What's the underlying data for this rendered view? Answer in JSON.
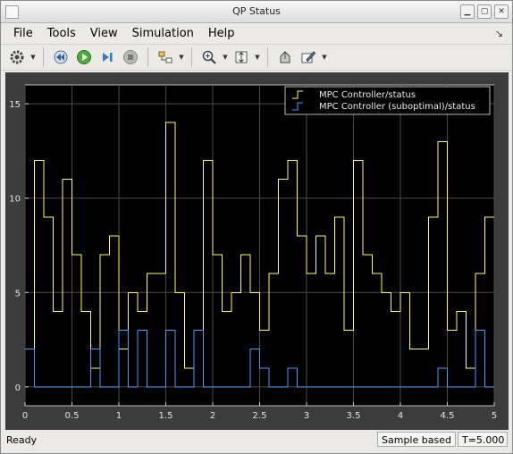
{
  "window": {
    "title": "QP Status",
    "dock_glyph": "↘"
  },
  "menu": {
    "items": [
      "File",
      "Tools",
      "View",
      "Simulation",
      "Help"
    ]
  },
  "toolbar": {
    "icons": [
      "gear-icon",
      "step-back-icon",
      "run-icon",
      "step-forward-icon",
      "stop-icon",
      "signal-select-icon",
      "zoom-icon",
      "autoscale-icon",
      "highlight-block-icon",
      "style-icon"
    ]
  },
  "colors": {
    "series1": "#ffff55",
    "series2": "#4a9cff",
    "axes_bg": "#000000",
    "frame_bg": "#3c3c3c"
  },
  "chart_data": {
    "type": "line",
    "step": true,
    "xlim": [
      0,
      5
    ],
    "ylim": [
      -1,
      16
    ],
    "x_ticks": [
      0,
      0.5,
      1,
      1.5,
      2,
      2.5,
      3,
      3.5,
      4,
      4.5,
      5
    ],
    "x_tick_labels": [
      "0",
      "0.5",
      "1",
      "1.5",
      "2",
      "2.5",
      "3",
      "3.5",
      "4",
      "4.5",
      "5"
    ],
    "y_ticks": [
      0,
      5,
      10,
      15
    ],
    "y_tick_labels": [
      "0",
      "5",
      "10",
      "15"
    ],
    "grid": true,
    "legend_position": "top-right",
    "series": [
      {
        "name": "MPC Controller/status",
        "color": "#ffff55",
        "x": [
          0,
          0.1,
          0.2,
          0.3,
          0.4,
          0.5,
          0.6,
          0.7,
          0.8,
          0.9,
          1.0,
          1.1,
          1.2,
          1.3,
          1.4,
          1.5,
          1.6,
          1.7,
          1.8,
          1.9,
          2.0,
          2.1,
          2.2,
          2.3,
          2.4,
          2.5,
          2.6,
          2.7,
          2.8,
          2.9,
          3.0,
          3.1,
          3.2,
          3.3,
          3.4,
          3.5,
          3.6,
          3.7,
          3.8,
          3.9,
          4.0,
          4.1,
          4.2,
          4.3,
          4.4,
          4.5,
          4.6,
          4.7,
          4.8,
          4.9,
          5.0
        ],
        "values": [
          2,
          12,
          9,
          4,
          11,
          7,
          4,
          1,
          7,
          8,
          2,
          5,
          4,
          6,
          6,
          14,
          5,
          1,
          3,
          12,
          7,
          4,
          5,
          7,
          5,
          3,
          6,
          11,
          12,
          8,
          6,
          8,
          6,
          9,
          3,
          12,
          7,
          6,
          5,
          4,
          5,
          2,
          2,
          9,
          13,
          3,
          4,
          1,
          6,
          9,
          9
        ]
      },
      {
        "name": "MPC Controller (suboptimal)/status",
        "color": "#4a9cff",
        "x": [
          0,
          0.1,
          0.2,
          0.3,
          0.4,
          0.5,
          0.6,
          0.7,
          0.8,
          0.9,
          1.0,
          1.1,
          1.2,
          1.3,
          1.4,
          1.5,
          1.6,
          1.7,
          1.8,
          1.9,
          2.0,
          2.1,
          2.2,
          2.3,
          2.4,
          2.5,
          2.6,
          2.7,
          2.8,
          2.9,
          3.0,
          3.1,
          3.2,
          3.3,
          3.4,
          3.5,
          3.6,
          3.7,
          3.8,
          3.9,
          4.0,
          4.1,
          4.2,
          4.3,
          4.4,
          4.5,
          4.6,
          4.7,
          4.8,
          4.9,
          5.0
        ],
        "values": [
          2,
          0,
          0,
          0,
          0,
          0,
          0,
          2,
          0,
          0,
          3,
          0,
          3,
          0,
          0,
          3,
          0,
          0,
          3,
          0,
          0,
          0,
          0,
          0,
          2,
          1,
          0,
          0,
          1,
          0,
          0,
          0,
          0,
          0,
          0,
          0,
          0,
          0,
          0,
          0,
          0,
          0,
          0,
          0,
          1,
          0,
          0,
          0,
          3,
          0,
          0
        ]
      }
    ]
  },
  "status": {
    "ready": "Ready",
    "sample_mode": "Sample based",
    "time": "T=5.000"
  }
}
